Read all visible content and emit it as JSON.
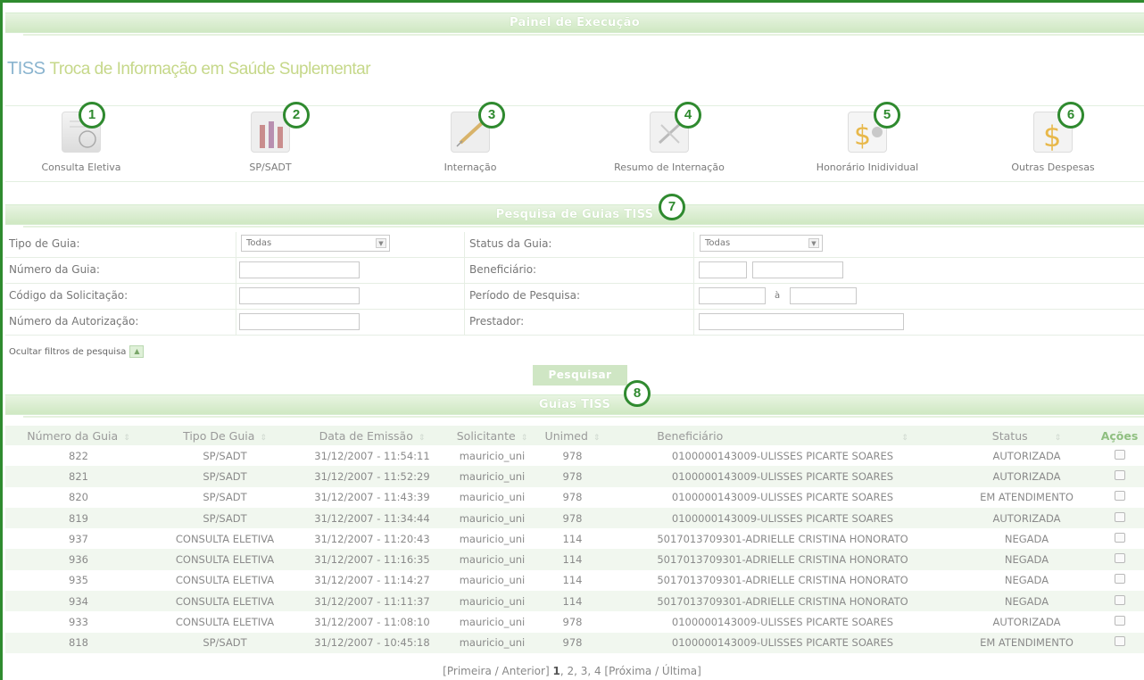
{
  "header": {
    "title": "Painel de Execução"
  },
  "brand": {
    "tiss": "TISS",
    "subtitle": "Troca de Informação em Saúde Suplementar"
  },
  "guide_types": [
    {
      "label": "Consulta Eletiva",
      "badge": "1"
    },
    {
      "label": "SP/SADT",
      "badge": "2"
    },
    {
      "label": "Internação",
      "badge": "3"
    },
    {
      "label": "Resumo de Internação",
      "badge": "4"
    },
    {
      "label": "Honorário Inidividual",
      "badge": "5"
    },
    {
      "label": "Outras Despesas",
      "badge": "6"
    }
  ],
  "search": {
    "title": "Pesquisa de Guias TISS",
    "badge": "7",
    "tipo_label": "Tipo de Guia:",
    "tipo_value": "Todas",
    "status_label": "Status da Guia:",
    "status_value": "Todas",
    "numero_label": "Número da Guia:",
    "beneficiario_label": "Beneficiário:",
    "codigo_label": "Código da Solicitação:",
    "periodo_label": "Período de Pesquisa:",
    "periodo_sep": "à",
    "autorizacao_label": "Número da Autorização:",
    "prestador_label": "Prestador:",
    "hide_filters": "Ocultar filtros de pesquisa",
    "button": "Pesquisar"
  },
  "results": {
    "title": "Guias TISS",
    "badge": "8",
    "columns": [
      "Número da Guia",
      "Tipo De Guia",
      "Data de Emissão",
      "Solicitante",
      "Unimed",
      "Beneficiário",
      "Status",
      "Ações"
    ],
    "rows": [
      [
        "822",
        "SP/SADT",
        "31/12/2007 - 11:54:11",
        "mauricio_uni",
        "978",
        "0100000143009-ULISSES PICARTE SOARES",
        "AUTORIZADA"
      ],
      [
        "821",
        "SP/SADT",
        "31/12/2007 - 11:52:29",
        "mauricio_uni",
        "978",
        "0100000143009-ULISSES PICARTE SOARES",
        "AUTORIZADA"
      ],
      [
        "820",
        "SP/SADT",
        "31/12/2007 - 11:43:39",
        "mauricio_uni",
        "978",
        "0100000143009-ULISSES PICARTE SOARES",
        "EM ATENDIMENTO"
      ],
      [
        "819",
        "SP/SADT",
        "31/12/2007 - 11:34:44",
        "mauricio_uni",
        "978",
        "0100000143009-ULISSES PICARTE SOARES",
        "AUTORIZADA"
      ],
      [
        "937",
        "CONSULTA ELETIVA",
        "31/12/2007 - 11:20:43",
        "mauricio_uni",
        "114",
        "5017013709301-ADRIELLE CRISTINA HONORATO",
        "NEGADA"
      ],
      [
        "936",
        "CONSULTA ELETIVA",
        "31/12/2007 - 11:16:35",
        "mauricio_uni",
        "114",
        "5017013709301-ADRIELLE CRISTINA HONORATO",
        "NEGADA"
      ],
      [
        "935",
        "CONSULTA ELETIVA",
        "31/12/2007 - 11:14:27",
        "mauricio_uni",
        "114",
        "5017013709301-ADRIELLE CRISTINA HONORATO",
        "NEGADA"
      ],
      [
        "934",
        "CONSULTA ELETIVA",
        "31/12/2007 - 11:11:37",
        "mauricio_uni",
        "114",
        "5017013709301-ADRIELLE CRISTINA HONORATO",
        "NEGADA"
      ],
      [
        "933",
        "CONSULTA ELETIVA",
        "31/12/2007 - 11:08:10",
        "mauricio_uni",
        "978",
        "0100000143009-ULISSES PICARTE SOARES",
        "AUTORIZADA"
      ],
      [
        "818",
        "SP/SADT",
        "31/12/2007 - 10:45:18",
        "mauricio_uni",
        "978",
        "0100000143009-ULISSES PICARTE SOARES",
        "EM ATENDIMENTO"
      ]
    ],
    "action_icon": "printer-icon"
  },
  "pager": {
    "prefix": "[Primeira / Anterior]",
    "current": "1",
    "rest": ", 2, 3, 4 [Próxima / Última]"
  },
  "colors": {
    "accent": "#2e8b2e",
    "banner": "#cfe8c2",
    "row_alt": "#f1f7ef"
  }
}
